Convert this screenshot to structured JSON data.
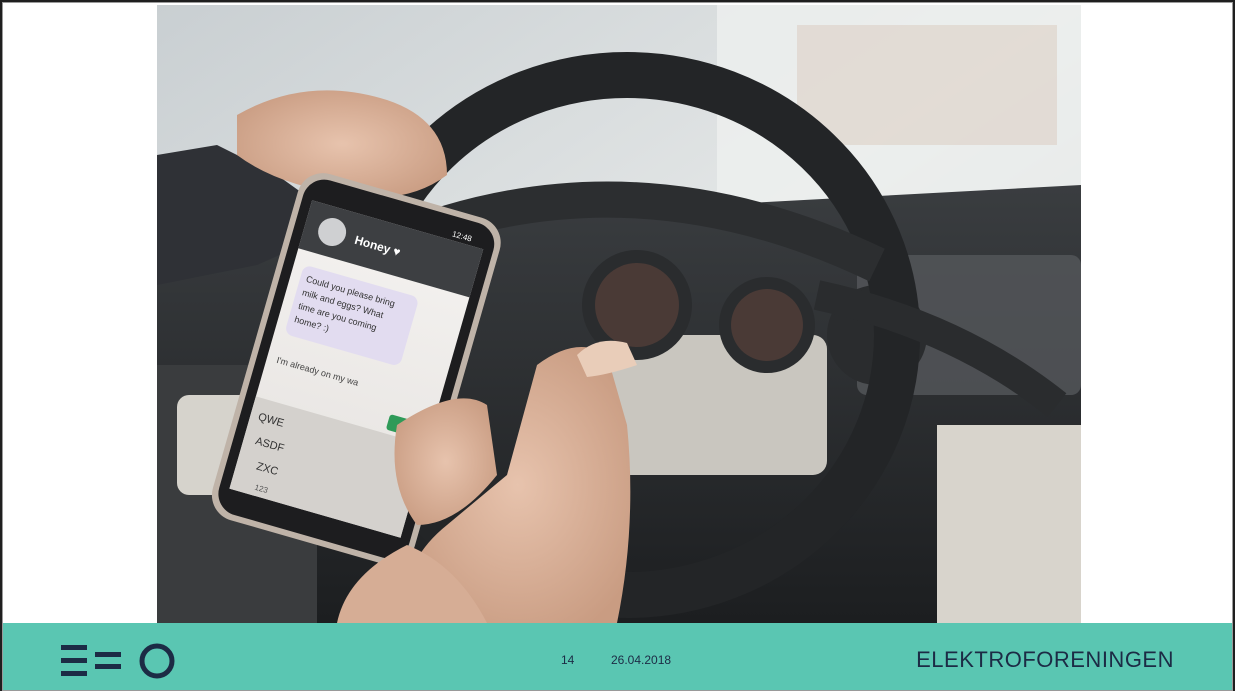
{
  "footer": {
    "page_number": "14",
    "date": "26.04.2018",
    "brand": "ELEKTROFORENINGEN",
    "logo_icon": "eeo-logo-icon",
    "background_color": "#5ac6b2",
    "text_color": "#1c2b45"
  },
  "photo": {
    "phone": {
      "time": "12:48",
      "contact": "Honey ♥",
      "message_in_1": "Could you please bring",
      "message_in_2": "milk and eggs? What",
      "message_in_3": "time are you coming",
      "message_in_4": "home? :)",
      "message_out": "I'm already on my wa",
      "keyboard_row_1": "QWE",
      "keyboard_row_2": "ASDF",
      "keyboard_row_3": "ZXC",
      "keyboard_mode": "123"
    }
  }
}
